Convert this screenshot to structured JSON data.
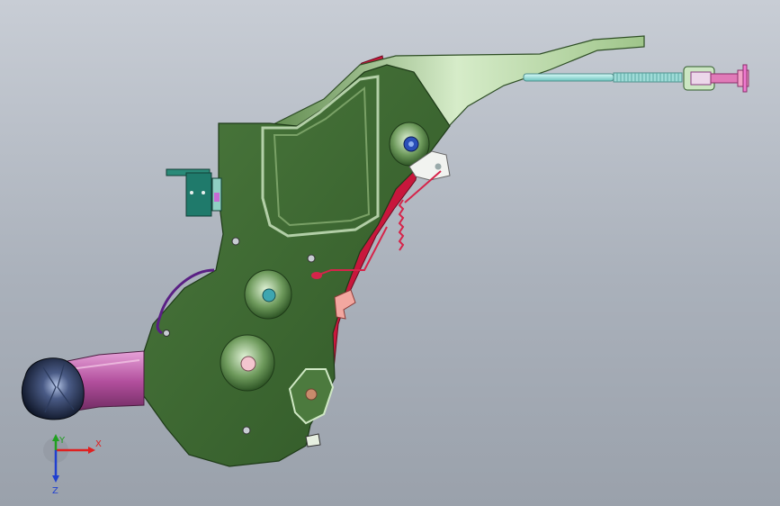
{
  "viewport": {
    "background_top": "#c8cdd5",
    "background_bottom": "#9aa1ab"
  },
  "model": {
    "bracket_color": "#3f6b34",
    "flange_color": "#cfe8c4",
    "cable_color": "#8ed6d2",
    "spring_color": "#d6244a",
    "handle_grip_color": "#b95aa6",
    "knob_color": "#1a2540",
    "pivot_colors": [
      "#2a4fb8",
      "#3ea6b0",
      "#f3c6cf",
      "#c88b6c"
    ]
  },
  "triad": {
    "x_label": "X",
    "y_label": "Y",
    "z_label": "Z",
    "x_color": "#e02020",
    "y_color": "#20a020",
    "z_color": "#2040d0"
  }
}
